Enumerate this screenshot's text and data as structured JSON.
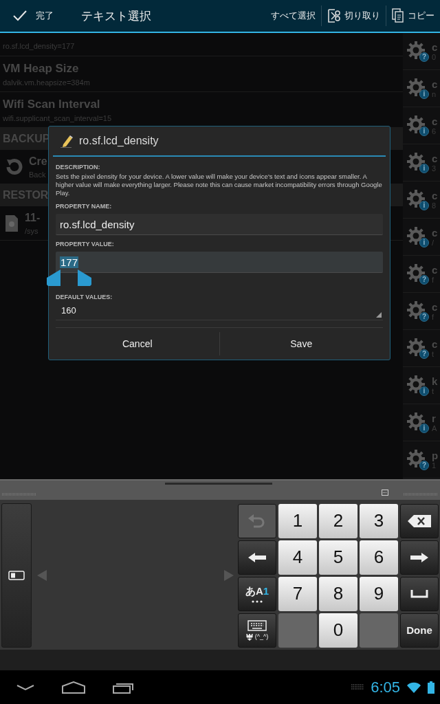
{
  "action_bar": {
    "done": "完了",
    "title": "テキスト選択",
    "actions": [
      {
        "kind": "select_all",
        "label": "すべて選択"
      },
      {
        "kind": "cut",
        "label": "切り取り"
      },
      {
        "kind": "copy",
        "label": "コピー"
      }
    ]
  },
  "list": [
    {
      "kind": "item",
      "subtitle": "ro.sf.lcd_density=177"
    },
    {
      "kind": "item",
      "title": "VM Heap Size",
      "subtitle": "dalvik.vm.heapsize=384m"
    },
    {
      "kind": "item",
      "title": "Wifi Scan Interval",
      "subtitle": "wifi.supplicant_scan_interval=15"
    },
    {
      "kind": "header",
      "title": "BACKUP"
    },
    {
      "kind": "backup",
      "title": "Cre",
      "subtitle": "Back"
    },
    {
      "kind": "header",
      "title": "RESTOR"
    },
    {
      "kind": "restore",
      "title": "11-",
      "subtitle": "/sys"
    }
  ],
  "side_list": [
    {
      "title": "c",
      "subtitle": "0",
      "badge": "?"
    },
    {
      "title": "c",
      "subtitle": "n",
      "badge": "i"
    },
    {
      "title": "c",
      "subtitle": "6",
      "badge": "i"
    },
    {
      "title": "c",
      "subtitle": "3",
      "badge": "i"
    },
    {
      "title": "c",
      "subtitle": "8",
      "badge": "i"
    },
    {
      "title": "c",
      "subtitle": "/",
      "badge": "i"
    },
    {
      "title": "c",
      "subtitle": "f",
      "badge": "?"
    },
    {
      "title": "c",
      "subtitle": "f",
      "badge": "?"
    },
    {
      "title": "c",
      "subtitle": "t",
      "badge": "?"
    },
    {
      "title": "k",
      "subtitle": "t",
      "badge": "i"
    },
    {
      "title": "r",
      "subtitle": "A",
      "badge": "i"
    },
    {
      "title": "p",
      "subtitle": "1",
      "badge": "?"
    }
  ],
  "dialog": {
    "title": "ro.sf.lcd_density",
    "description_label": "DESCRIPTION:",
    "description": "Sets the pixel density for your device. A lower value will make your device's text and icons appear smaller. A higher value will make everything larger. Please note this can cause market incompatibility errors through Google Play.",
    "name_label": "PROPERTY NAME:",
    "name_value": "ro.sf.lcd_density",
    "value_label": "PROPERTY VALUE:",
    "value": "177",
    "default_label": "DEFAULT VALUES:",
    "default_value": "160",
    "buttons": [
      "Cancel",
      "Save"
    ]
  },
  "keyboard": {
    "rows": [
      [
        {
          "kind": "undo",
          "disabled": true
        },
        {
          "kind": "digit",
          "label": "1",
          "disabled": false
        },
        {
          "kind": "digit",
          "label": "2",
          "disabled": false
        },
        {
          "kind": "digit",
          "label": "3",
          "disabled": false
        },
        {
          "kind": "backspace",
          "disabled": false
        }
      ],
      [
        {
          "kind": "left",
          "disabled": false
        },
        {
          "kind": "digit",
          "label": "4",
          "disabled": false
        },
        {
          "kind": "digit",
          "label": "5",
          "disabled": false
        },
        {
          "kind": "digit",
          "label": "6",
          "disabled": false
        },
        {
          "kind": "right",
          "disabled": false
        }
      ],
      [
        {
          "kind": "mode",
          "label": "あA",
          "accent": "1",
          "disabled": false
        },
        {
          "kind": "digit",
          "label": "7",
          "disabled": false
        },
        {
          "kind": "digit",
          "label": "8",
          "disabled": false
        },
        {
          "kind": "digit",
          "label": "9",
          "disabled": false
        },
        {
          "kind": "space",
          "disabled": false
        }
      ],
      [
        {
          "kind": "emoji",
          "label": "(^_^)",
          "disabled": false
        },
        {
          "kind": "blank",
          "disabled": true
        },
        {
          "kind": "digit",
          "label": "0",
          "disabled": false
        },
        {
          "kind": "blank",
          "disabled": true
        },
        {
          "kind": "done",
          "label": "Done",
          "disabled": false
        }
      ]
    ]
  },
  "nav_bar": {
    "time": "6:05"
  }
}
